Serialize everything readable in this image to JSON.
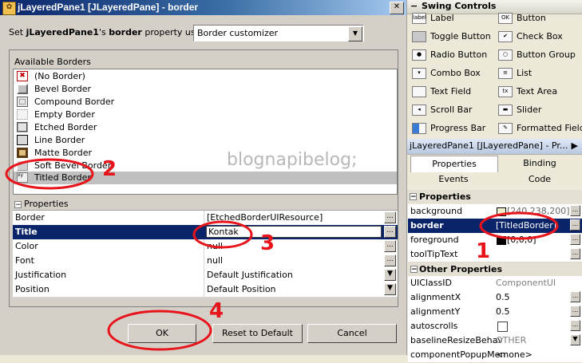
{
  "dialog": {
    "title": "jLayeredPane1 [JLayeredPane] - border",
    "close_glyph": "✕",
    "prop_prefix": "Set ",
    "prop_component": "jLayeredPane1",
    "prop_mid": "'s ",
    "prop_name": "border",
    "prop_suffix": " property using:",
    "customizer": "Border customizer",
    "available_label": "Available Borders",
    "borders": [
      {
        "label": "(No Border)",
        "icon": "no-border-icon"
      },
      {
        "label": "Bevel Border",
        "icon": "bevel-border-icon"
      },
      {
        "label": "Compound Border",
        "icon": "compound-border-icon"
      },
      {
        "label": "Empty Border",
        "icon": "empty-border-icon"
      },
      {
        "label": "Etched Border",
        "icon": "etched-border-icon"
      },
      {
        "label": "Line Border",
        "icon": "line-border-icon"
      },
      {
        "label": "Matte Border",
        "icon": "matte-border-icon"
      },
      {
        "label": "Soft Bevel Border",
        "icon": "soft-bevel-border-icon"
      },
      {
        "label": "Titled Border",
        "icon": "titled-border-icon",
        "selected": true
      }
    ],
    "properties_label": "Properties",
    "properties": [
      {
        "name": "Border",
        "value": "[EtchedBorderUIResource]",
        "button": "..."
      },
      {
        "name": "Title",
        "value": "Kontak",
        "button": "...",
        "selected": true
      },
      {
        "name": "Color",
        "value": "null",
        "button": "..."
      },
      {
        "name": "Font",
        "value": "null",
        "button": "..."
      },
      {
        "name": "Justification",
        "value": "Default Justification",
        "button": "▼"
      },
      {
        "name": "Position",
        "value": "Default Position",
        "button": "▼"
      }
    ],
    "buttons": {
      "ok": "OK",
      "reset": "Reset to Default",
      "cancel": "Cancel"
    }
  },
  "palette": {
    "title": "Swing Controls",
    "items": [
      {
        "label": "Label",
        "icon": "label-icon",
        "glyph": "label"
      },
      {
        "label": "Button",
        "icon": "button-icon",
        "glyph": "OK"
      },
      {
        "label": "Toggle Button",
        "icon": "toggle-button-icon",
        "glyph": ""
      },
      {
        "label": "Check Box",
        "icon": "check-box-icon",
        "glyph": "✔"
      },
      {
        "label": "Radio Button",
        "icon": "radio-button-icon",
        "glyph": "●"
      },
      {
        "label": "Button Group",
        "icon": "button-group-icon",
        "glyph": "○"
      },
      {
        "label": "Combo Box",
        "icon": "combo-box-icon",
        "glyph": "▾"
      },
      {
        "label": "List",
        "icon": "list-icon",
        "glyph": "≡"
      },
      {
        "label": "Text Field",
        "icon": "text-field-icon",
        "glyph": ""
      },
      {
        "label": "Text Area",
        "icon": "text-area-icon",
        "glyph": "tx"
      },
      {
        "label": "Scroll Bar",
        "icon": "scroll-bar-icon",
        "glyph": "◂"
      },
      {
        "label": "Slider",
        "icon": "slider-icon",
        "glyph": "▬"
      },
      {
        "label": "Progress Bar",
        "icon": "progress-bar-icon",
        "glyph": ""
      },
      {
        "label": "Formatted Field",
        "icon": "formatted-field-icon",
        "glyph": "✎"
      }
    ]
  },
  "inspector": {
    "title": "jLayeredPane1 [JLayeredPane] - Pr...",
    "tabs": [
      "Properties",
      "Binding",
      "Events",
      "Code"
    ],
    "properties_section": "Properties",
    "properties": [
      {
        "name": "background",
        "value": "[240,238,200]"
      },
      {
        "name": "border",
        "value": "[TitledBorder]",
        "selected": true
      },
      {
        "name": "foreground",
        "value": "[0,0,0]"
      },
      {
        "name": "toolTipText",
        "value": ""
      }
    ],
    "other_section": "Other Properties",
    "other": [
      {
        "name": "UIClassID",
        "value": "ComponentUI"
      },
      {
        "name": "alignmentX",
        "value": "0.5"
      },
      {
        "name": "alignmentY",
        "value": "0.5"
      },
      {
        "name": "autoscrolls",
        "value": ""
      },
      {
        "name": "baselineResizeBehav",
        "value": "OTHER"
      },
      {
        "name": "componentPopupMen",
        "value": "<none>"
      }
    ]
  },
  "annotations": {
    "watermark": "blognapibelog;",
    "marks": [
      "1",
      "2",
      "3",
      "4"
    ],
    "color": "#e8141b"
  }
}
